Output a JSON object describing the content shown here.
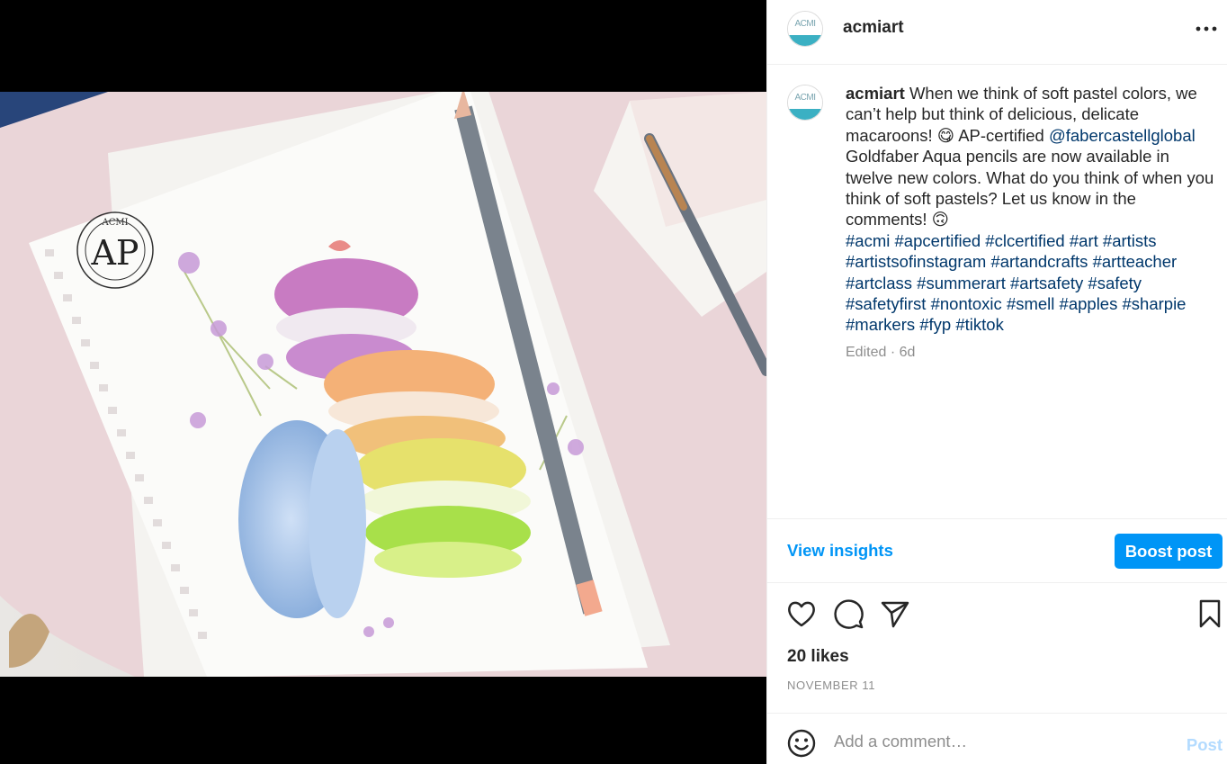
{
  "post": {
    "username": "acmiart",
    "avatar_text": "ACMI",
    "caption_username": "acmiart",
    "caption_text_1": "When we think of soft pastel colors, we can’t help but think of delicious, delicate macaroons! 😋 AP-certified ",
    "mention": "@fabercastellglobal",
    "caption_text_2": " Goldfaber Aqua pencils are now available in twelve new colors. What do you think of when you think of soft pastels? Let us know in the comments! 🙃",
    "hashtags": [
      "#acmi",
      "#apcertified",
      "#clcertified",
      "#art",
      "#artists",
      "#artistsofinstagram",
      "#artandcrafts",
      "#artteacher",
      "#artclass",
      "#summerart",
      "#artsafety",
      "#safety",
      "#safetyfirst",
      "#nontoxic",
      "#smell",
      "#apples",
      "#sharpie",
      "#markers",
      "#fyp",
      "#tiktok"
    ],
    "meta": "Edited · 6d",
    "likes": "20 likes",
    "date": "NOVEMBER 11"
  },
  "insights": {
    "view_label": "View insights",
    "boost_label": "Boost post"
  },
  "comment": {
    "placeholder": "Add a comment…",
    "post_label": "Post"
  },
  "image": {
    "seal_text": "AP",
    "seal_ring_text": "ACMI"
  },
  "icons": {
    "more": "more-icon",
    "like": "heart-icon",
    "comment": "comment-icon",
    "share": "paper-plane-icon",
    "save": "bookmark-icon",
    "emoji": "smiley-icon"
  },
  "colors": {
    "accent": "#0095f6",
    "link": "#00376b",
    "muted": "#8e8e8e"
  }
}
